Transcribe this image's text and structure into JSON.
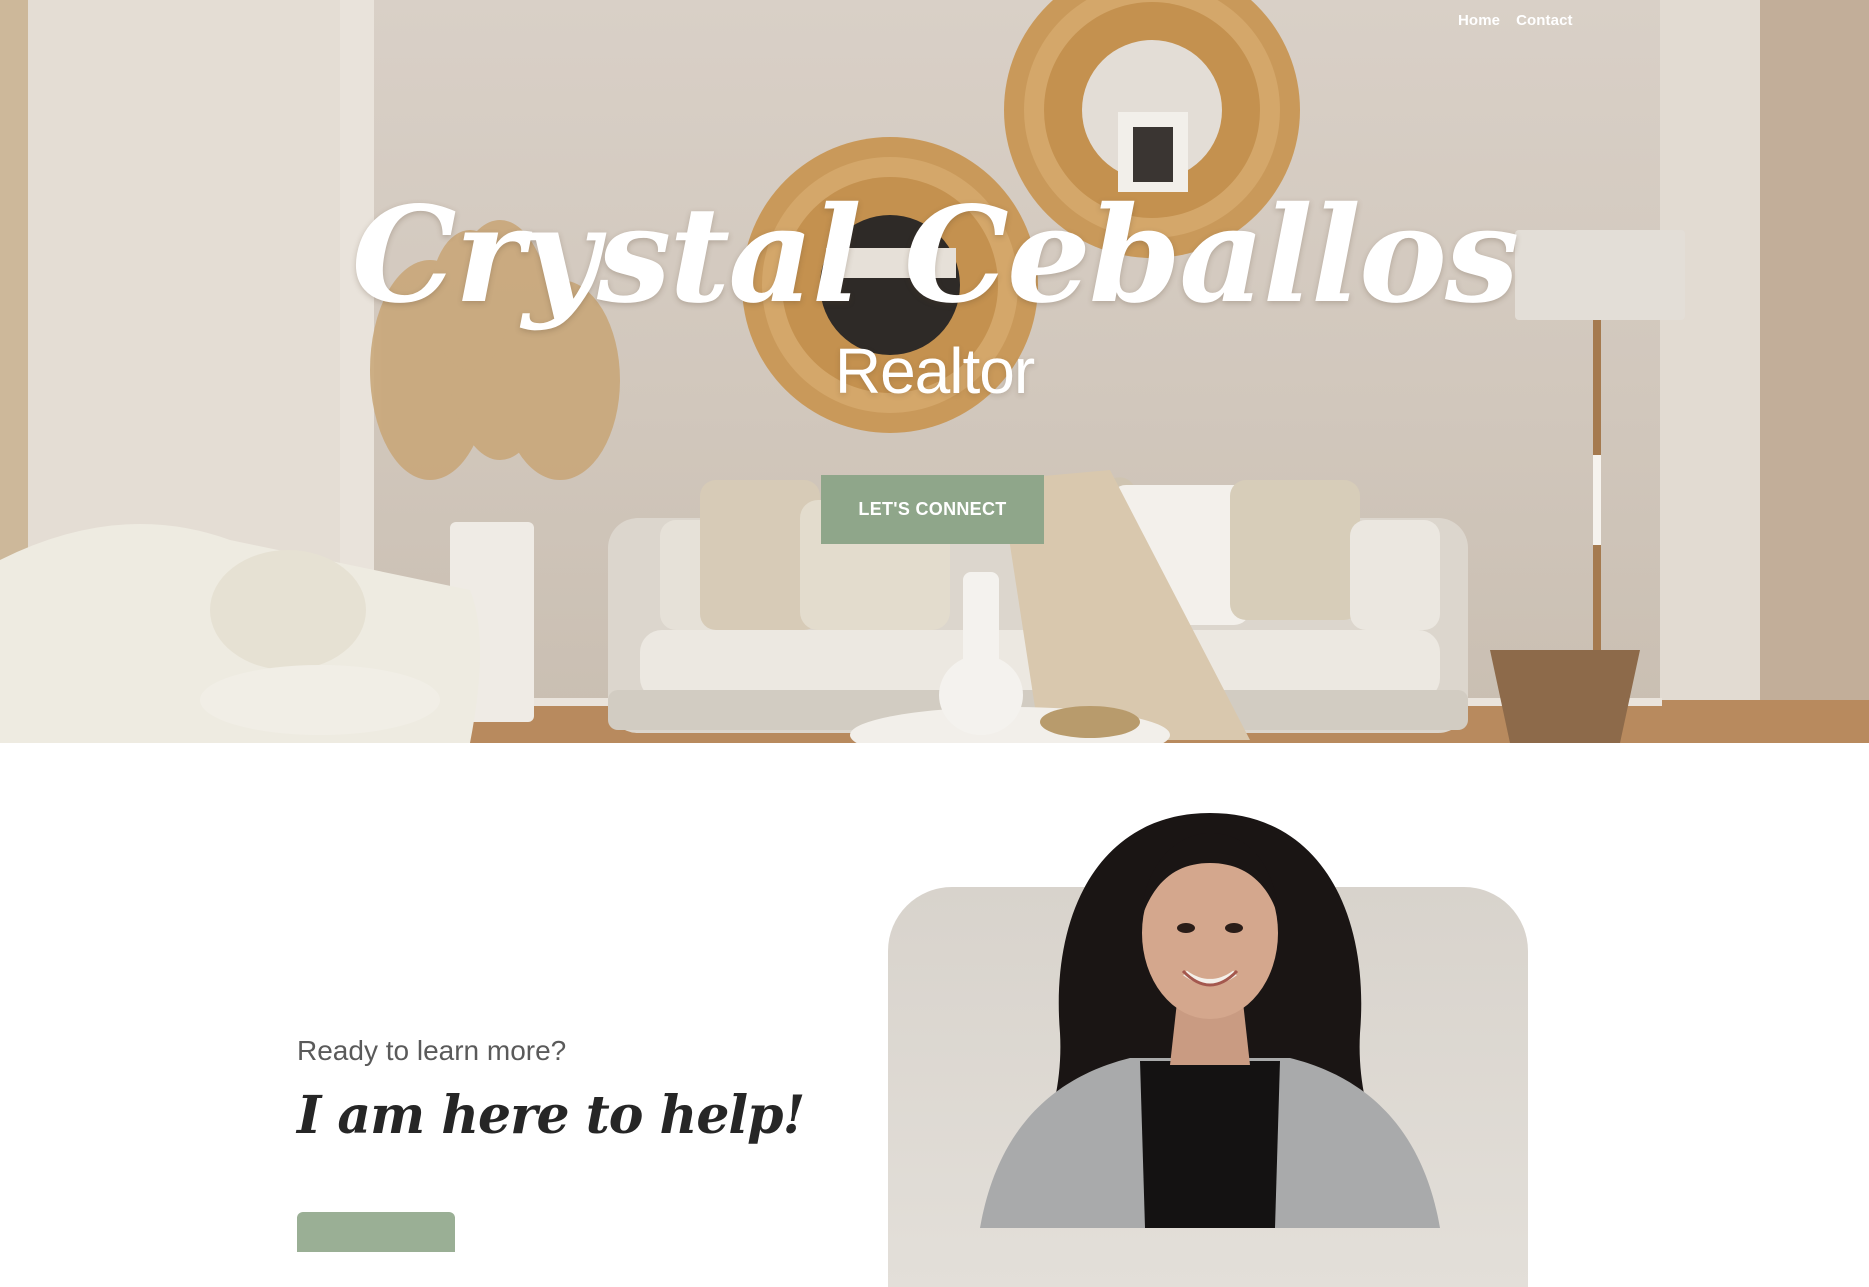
{
  "nav": {
    "items": [
      {
        "label": "Home"
      },
      {
        "label": "Contact"
      }
    ]
  },
  "hero": {
    "name": "Crystal Ceballos",
    "subtitle": "Realtor",
    "cta_label": "LET'S CONNECT",
    "background_image": "living-room-photo"
  },
  "about": {
    "eyebrow": "Ready to learn more?",
    "headline": "I am here to help!",
    "button_label": "",
    "portrait_image": "realtor-portrait-photo"
  },
  "colors": {
    "accent_green": "#8fa68a",
    "text_dark": "#262626",
    "text_muted": "#5a5a5a"
  }
}
